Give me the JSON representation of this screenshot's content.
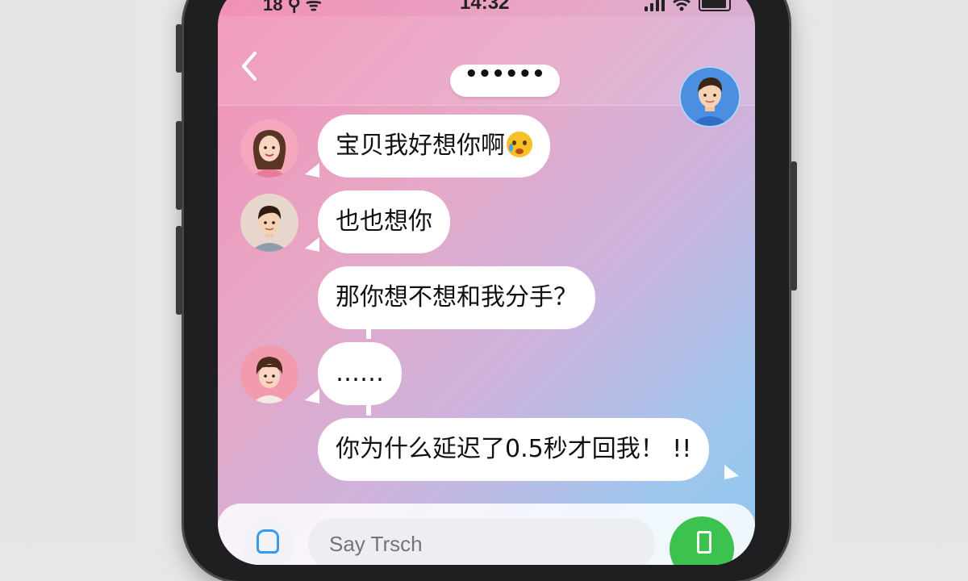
{
  "status_bar": {
    "carrier": "18 ⚲ ᯤ",
    "time": "14:32"
  },
  "header": {
    "back_glyph": "‹",
    "title": "••••••"
  },
  "messages": [
    {
      "side": "left",
      "text": "宝贝我好想你啊",
      "emoji": "crying-face"
    },
    {
      "side": "left",
      "text": "也也想你"
    },
    {
      "side": "left",
      "text": "那你想不想和我分手？"
    },
    {
      "side": "left",
      "text": "……"
    },
    {
      "side": "right",
      "text": "你为什么延迟了0.5秒才回我！ !!"
    }
  ],
  "input": {
    "placeholder": "Say Trsch"
  },
  "icons": {
    "back": "chevron-left-icon",
    "voice": "voice-icon",
    "send": "send-icon"
  },
  "colors": {
    "send_button": "#3cc24f",
    "gradient_start": "#f28fb5",
    "gradient_end": "#8fc5f0"
  }
}
